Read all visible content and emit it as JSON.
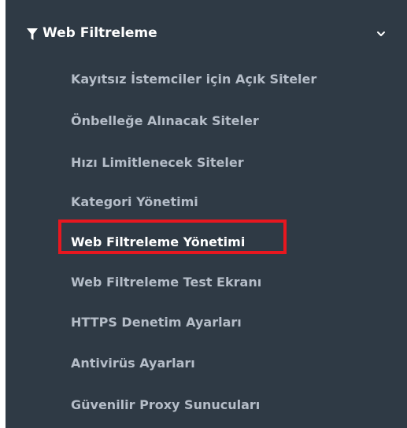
{
  "menu": {
    "title": "Web Filtreleme",
    "title_icon": "filter-icon",
    "expand_icon": "chevron-down-icon",
    "items": [
      {
        "label": "Kayıtsız İstemciler için Açık Siteler"
      },
      {
        "label": "Önbelleğe Alınacak Siteler"
      },
      {
        "label": "Hızı Limitlenecek Siteler"
      },
      {
        "label": "Kategori Yönetimi"
      },
      {
        "label": "Web Filtreleme Yönetimi",
        "active": true
      },
      {
        "label": "Web Filtreleme Test Ekranı"
      },
      {
        "label": "HTTPS Denetim Ayarları"
      },
      {
        "label": "Antivirüs Ayarları"
      },
      {
        "label": "Güvenilir Proxy Sunucuları"
      }
    ]
  },
  "colors": {
    "panel_bg": "#2f3a45",
    "item_text": "#b5bdc8",
    "active_text": "#ffffff",
    "highlight": "#e8171f"
  }
}
